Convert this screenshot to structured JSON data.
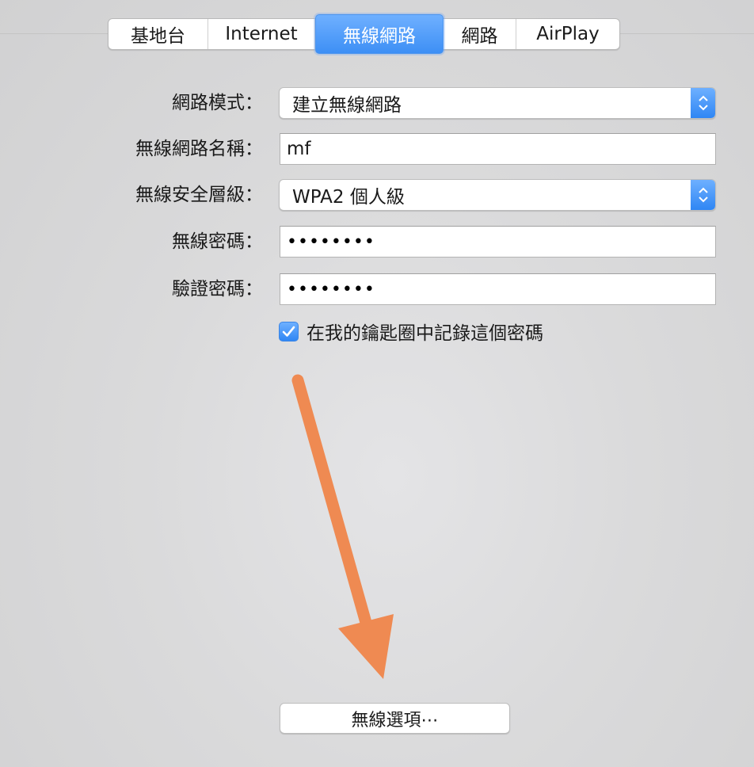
{
  "tabs": [
    {
      "label": "基地台"
    },
    {
      "label": "Internet"
    },
    {
      "label": "無線網路"
    },
    {
      "label": "網路"
    },
    {
      "label": "AirPlay"
    }
  ],
  "active_tab": "無線網路",
  "form": {
    "network_mode": {
      "label": "網路模式：",
      "value": "建立無線網路"
    },
    "network_name": {
      "label": "無線網路名稱：",
      "value": "mf"
    },
    "security": {
      "label": "無線安全層級：",
      "value": "WPA2 個人級"
    },
    "password": {
      "label": "無線密碼：",
      "value": "••••••••"
    },
    "verify_password": {
      "label": "驗證密碼：",
      "value": "••••••••"
    },
    "remember_keychain": {
      "label": "在我的鑰匙圈中記錄這個密碼",
      "checked": true
    }
  },
  "wireless_options_button": "無線選項⋯",
  "colors": {
    "accent": "#3d8ff5",
    "annotation_arrow": "#ef8a52"
  },
  "icons": {
    "popup_stepper": "up-down-chevron-icon",
    "checkbox": "checkmark-icon",
    "annotation": "arrow-down-icon"
  }
}
